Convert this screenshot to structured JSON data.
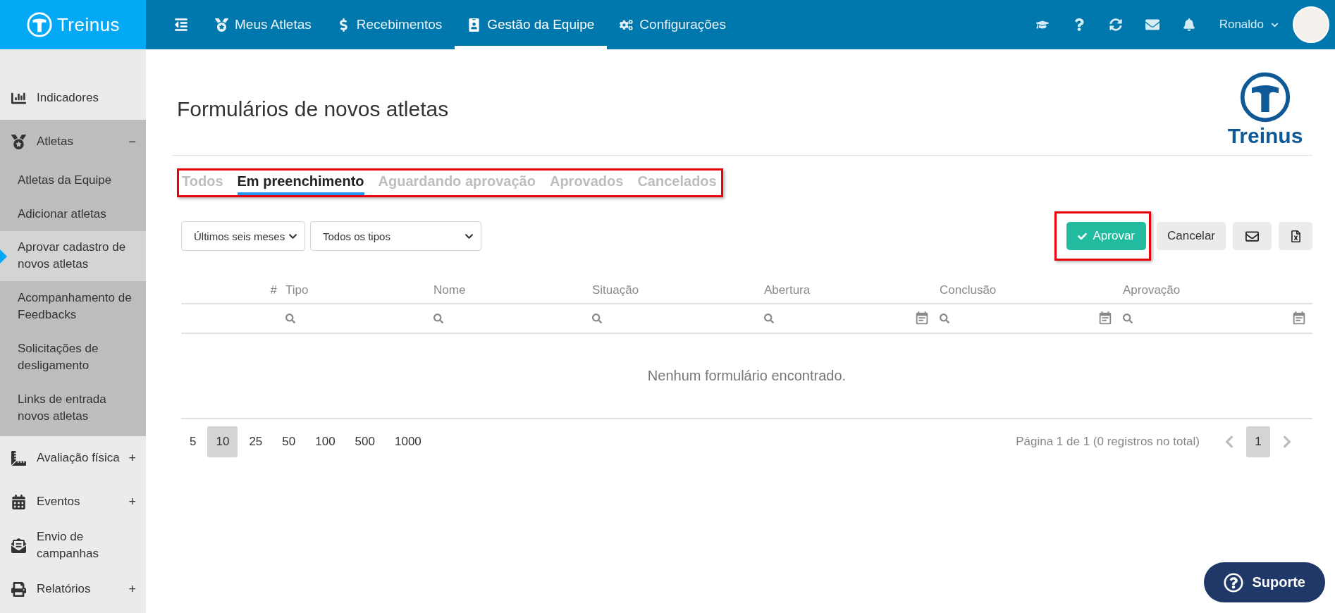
{
  "brand": {
    "name": "Treinus"
  },
  "nav": [
    {
      "label": "Meus Atletas",
      "selected": false
    },
    {
      "label": "Recebimentos",
      "selected": false
    },
    {
      "label": "Gestão da Equipe",
      "selected": true
    },
    {
      "label": "Configurações",
      "selected": false
    }
  ],
  "user": {
    "name": "Ronaldo"
  },
  "sidebar": {
    "items": [
      {
        "label": "Indicadores"
      },
      {
        "label": "Atletas",
        "toggle": "−",
        "expanded": true,
        "children": [
          {
            "label": "Atletas da Equipe",
            "selected": false
          },
          {
            "label": "Adicionar atletas",
            "selected": false
          },
          {
            "label": "Aprovar cadastro de novos atletas",
            "selected": true
          },
          {
            "label": "Acompanhamento de Feedbacks",
            "selected": false
          },
          {
            "label": "Solicitações de desligamento",
            "selected": false
          },
          {
            "label": "Links de entrada novos atletas",
            "selected": false
          }
        ]
      },
      {
        "label": "Avaliação física",
        "toggle": "+",
        "expanded": false
      },
      {
        "label": "Eventos",
        "toggle": "+",
        "expanded": false
      },
      {
        "label": "Envio de campanhas",
        "expanded": false
      },
      {
        "label": "Relatórios",
        "toggle": "+",
        "expanded": false
      }
    ]
  },
  "page": {
    "title": "Formulários de novos atletas",
    "logo_text": "Treinus"
  },
  "tabs": {
    "highlighted": true,
    "items": [
      {
        "label": "Todos",
        "selected": false
      },
      {
        "label": "Em preenchimento",
        "selected": true
      },
      {
        "label": "Aguardando aprovação",
        "selected": false
      },
      {
        "label": "Aprovados",
        "selected": false
      },
      {
        "label": "Cancelados",
        "selected": false
      }
    ]
  },
  "filters": [
    {
      "value": "Últimos seis meses"
    },
    {
      "value": "Todos os tipos"
    }
  ],
  "actions": {
    "approve": {
      "label": "Aprovar",
      "highlighted": true
    },
    "cancel": {
      "label": "Cancelar"
    }
  },
  "table": {
    "columns": [
      {
        "label": "#",
        "kind": "none"
      },
      {
        "label": "Tipo",
        "kind": "text"
      },
      {
        "label": "Nome",
        "kind": "text"
      },
      {
        "label": "Situação",
        "kind": "text"
      },
      {
        "label": "Abertura",
        "kind": "date"
      },
      {
        "label": "Conclusão",
        "kind": "date"
      },
      {
        "label": "Aprovação",
        "kind": "date"
      }
    ],
    "empty_message": "Nenhum formulário encontrado."
  },
  "page_sizes": [
    {
      "label": "5",
      "selected": false
    },
    {
      "label": "10",
      "selected": true
    },
    {
      "label": "25",
      "selected": false
    },
    {
      "label": "50",
      "selected": false
    },
    {
      "label": "100",
      "selected": false
    },
    {
      "label": "500",
      "selected": false
    },
    {
      "label": "1000",
      "selected": false
    }
  ],
  "pagination": {
    "summary": "Página 1 de 1 (0 registros no total)",
    "pages": [
      {
        "label": "1",
        "selected": true
      }
    ]
  },
  "support": {
    "label": "Suporte"
  }
}
